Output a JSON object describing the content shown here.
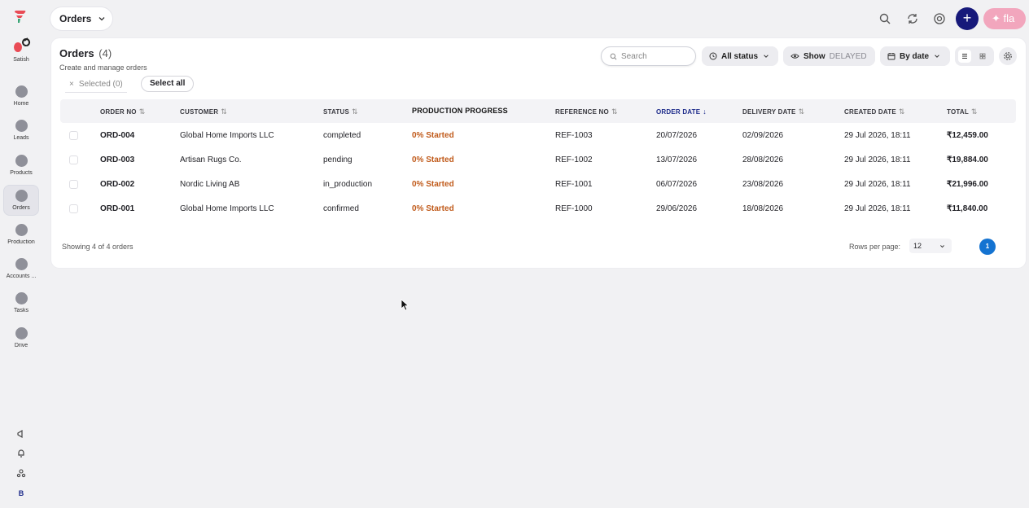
{
  "sidebar": {
    "user_name": "Satish",
    "items": [
      {
        "label": "Home",
        "icon": "home-icon"
      },
      {
        "label": "Leads",
        "icon": "leads-icon"
      },
      {
        "label": "Products",
        "icon": "products-icon"
      },
      {
        "label": "Orders",
        "icon": "orders-icon",
        "active": true
      },
      {
        "label": "Production",
        "icon": "production-icon"
      },
      {
        "label": "Accounts ...",
        "icon": "accounts-icon"
      },
      {
        "label": "Tasks",
        "icon": "tasks-icon"
      },
      {
        "label": "Drive",
        "icon": "drive-icon"
      }
    ],
    "bottom_badge": "B"
  },
  "topbar": {
    "section_label": "Orders",
    "fla_label": "✦ fla",
    "plus_label": "+"
  },
  "header": {
    "title": "Orders",
    "count": "(4)",
    "subtitle": "Create and manage orders"
  },
  "toolbar": {
    "search_placeholder": "Search",
    "status_filter": "All status",
    "show_label": "Show",
    "show_value": "DELAYED",
    "sort_label": "By date"
  },
  "selection": {
    "selected_label": "Selected (0)",
    "select_all_label": "Select all"
  },
  "table": {
    "columns": [
      "ORDER NO",
      "CUSTOMER",
      "STATUS",
      "PRODUCTION PROGRESS",
      "REFERENCE NO",
      "ORDER DATE",
      "DELIVERY DATE",
      "CREATED DATE",
      "TOTAL"
    ],
    "sorted_column": "ORDER DATE",
    "rows": [
      {
        "order_no": "ORD-004",
        "customer": "Global Home Imports LLC",
        "status": "completed",
        "progress": "0% Started",
        "ref": "REF-1003",
        "order_date": "20/07/2026",
        "delivery_date": "02/09/2026",
        "created": "29 Jul 2026, 18:11",
        "total": "₹12,459.00"
      },
      {
        "order_no": "ORD-003",
        "customer": "Artisan Rugs Co.",
        "status": "pending",
        "progress": "0% Started",
        "ref": "REF-1002",
        "order_date": "13/07/2026",
        "delivery_date": "28/08/2026",
        "created": "29 Jul 2026, 18:11",
        "total": "₹19,884.00"
      },
      {
        "order_no": "ORD-002",
        "customer": "Nordic Living AB",
        "status": "in_production",
        "progress": "0% Started",
        "ref": "REF-1001",
        "order_date": "06/07/2026",
        "delivery_date": "23/08/2026",
        "created": "29 Jul 2026, 18:11",
        "total": "₹21,996.00"
      },
      {
        "order_no": "ORD-001",
        "customer": "Global Home Imports LLC",
        "status": "confirmed",
        "progress": "0% Started",
        "ref": "REF-1000",
        "order_date": "29/06/2026",
        "delivery_date": "18/08/2026",
        "created": "29 Jul 2026, 18:11",
        "total": "₹11,840.00"
      }
    ]
  },
  "footer": {
    "showing": "Showing 4 of 4 orders",
    "rows_per_page_label": "Rows per page:",
    "rows_per_page_value": "12",
    "current_page": "1"
  },
  "colors": {
    "accent": "#17197a",
    "progress": "#c05a1a",
    "page_active": "#1473d1",
    "fla": "#f2a6bd"
  }
}
